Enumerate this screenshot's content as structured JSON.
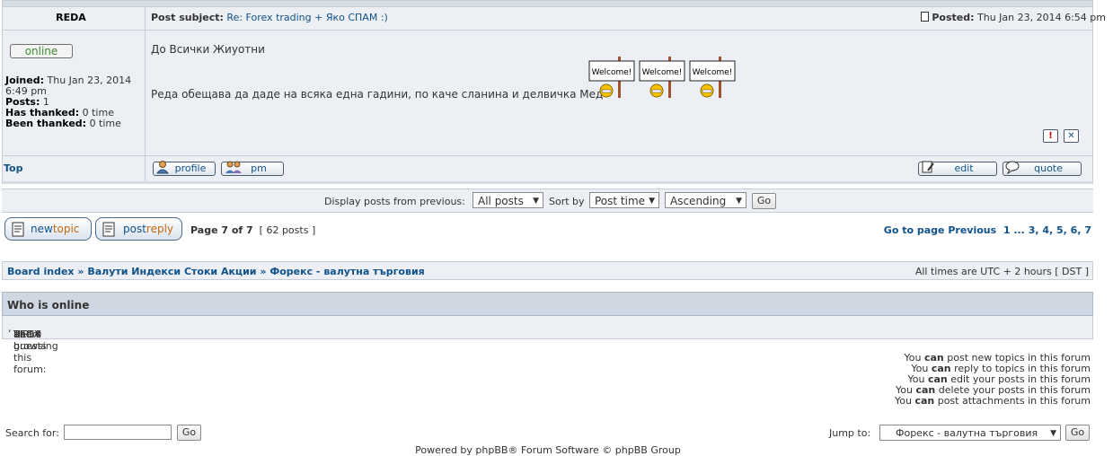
{
  "post": {
    "author": "REDA",
    "subject_label": "Post subject:",
    "subject": "Re: Forex trading + Яко СПАМ :)",
    "posted_label": "Posted:",
    "posted_date": "Thu Jan 23, 2014 6:54 pm",
    "online_badge": "online",
    "profile": {
      "joined_label": "Joined:",
      "joined_value": "Thu Jan 23, 2014 6:49 pm",
      "posts_label": "Posts:",
      "posts_value": "1",
      "has_thanked_label": "Has thanked:",
      "has_thanked_value": "0 time",
      "been_thanked_label": "Been thanked:",
      "been_thanked_value": "0 time"
    },
    "body_line1": "До Всички Жиуотни",
    "body_line2": "Реда обещава да даде на всяка една гадини, по каче сланина и делвичка Мед",
    "smiley_text": "Welcome!",
    "top_link": "Top",
    "buttons": {
      "profile": "profile",
      "pm": "pm",
      "edit": "edit",
      "quote": "quote"
    }
  },
  "display": {
    "label": "Display posts from previous:",
    "posts_value": "All posts",
    "sort_label": "Sort by",
    "sort_value": "Post time",
    "order_value": "Ascending",
    "go": "Go"
  },
  "actions": {
    "newtopic_a": "new",
    "newtopic_b": "topic",
    "postreply_a": "post",
    "postreply_b": "reply",
    "page_info": "Page 7 of 7",
    "posts_count": "[ 62 posts ]",
    "goto": "Go to page",
    "previous": "Previous",
    "pages": "1 ... 3, 4, 5, 6, 7"
  },
  "breadcrumb": {
    "board": "Board index",
    "sep": "»",
    "cat": "Валути Индекси Стоки Акции",
    "forum": "Форекс - валутна търговия",
    "timezone": "All times are UTC + 2 hours [ DST ]"
  },
  "who": {
    "title": "Who is online",
    "prefix": "Users browsing this forum:",
    "user1": "REDA",
    "user2": "TIPSY",
    "suffix": "and 0 guests"
  },
  "permissions": [
    {
      "pre": "You",
      "can": "can",
      "post": "post new topics in this forum"
    },
    {
      "pre": "You",
      "can": "can",
      "post": "reply to topics in this forum"
    },
    {
      "pre": "You",
      "can": "can",
      "post": "edit your posts in this forum"
    },
    {
      "pre": "You",
      "can": "can",
      "post": "delete your posts in this forum"
    },
    {
      "pre": "You",
      "can": "can",
      "post": "post attachments in this forum"
    }
  ],
  "footer": {
    "search_label": "Search for:",
    "go": "Go",
    "jump_label": "Jump to:",
    "jump_value": "Форекс - валутна търговия",
    "powered": "Powered by phpBB® Forum Software © phpBB Group"
  },
  "colors": {
    "link": "#105289",
    "panel": "#eceff3",
    "online": "#3c8d2f",
    "accent": "#c46a10"
  }
}
